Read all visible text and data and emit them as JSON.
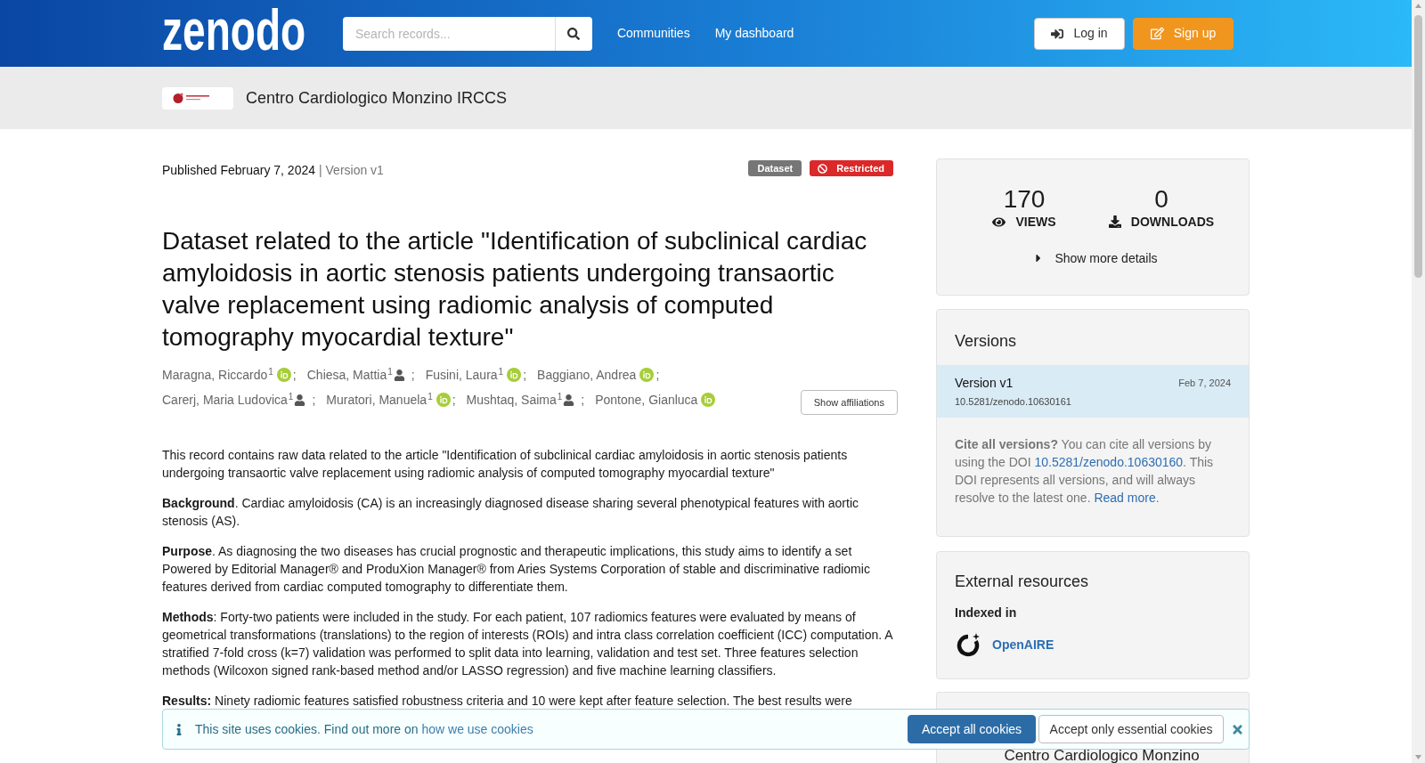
{
  "header": {
    "logo": "zenodo",
    "search": {
      "placeholder": "Search records..."
    },
    "nav": [
      "Communities",
      "My dashboard"
    ],
    "buttons": [
      {
        "label": "Log in",
        "kind": "login"
      },
      {
        "label": "Sign up",
        "kind": "signup"
      }
    ]
  },
  "community": {
    "name": "Centro Cardiologico Monzino IRCCS"
  },
  "record": {
    "published": "Published February 7, 2024",
    "version": "| Version v1",
    "badges": [
      {
        "label": "Dataset",
        "kind": "type"
      },
      {
        "label": "Restricted",
        "kind": "access"
      }
    ],
    "title": "Dataset related to the article \"Identification of subclinical cardiac amyloidosis in aortic stenosis patients undergoing transaortic valve replacement using radiomic analysis of computed tomography myocardial texture\"",
    "authors": [
      {
        "name": "Maragna, Riccardo",
        "affiliation": "1",
        "kind": "orcid",
        "separator": ";"
      },
      {
        "name": "Chiesa, Mattia",
        "affiliation": "1",
        "kind": "person",
        "separator": ";"
      },
      {
        "name": "Fusini, Laura",
        "affiliation": "1",
        "kind": "orcid",
        "separator": ";"
      },
      {
        "name": "Baggiano, Andrea",
        "kind": "orcid",
        "separator": ";"
      },
      {
        "name": "Carerj, Maria Ludovica",
        "affiliation": "1",
        "kind": "person",
        "separator": ";"
      },
      {
        "name": "Muratori, Manuela",
        "affiliation": "1",
        "kind": "orcid",
        "separator": ";"
      },
      {
        "name": "Mushtaq, Saima",
        "affiliation": "1",
        "kind": "person",
        "separator": ";"
      },
      {
        "name": "Pontone, Gianluca",
        "kind": "orcid"
      }
    ],
    "show_affiliations": "Show affiliations",
    "description": [
      "This record contains raw data related to the article \"Identification of subclinical cardiac amyloidosis in aortic stenosis patients undergoing transaortic valve replacement using radiomic analysis of computed tomography myocardial texture\"",
      "**Background**. Cardiac amyloidosis (CA) is an increasingly diagnosed disease sharing several phenotypical features with aortic stenosis (AS).",
      "**Purpose**. As diagnosing the two diseases has crucial prognostic and therapeutic implications, this study aims to identify a set Powered by Editorial Manager® and ProduXion Manager® from Aries Systems Corporation of stable and discriminative radiomic features derived from cardiac computed tomography to differentiate them.",
      "**Methods**: Forty-two patients were included in the study. For each patient, 107 radiomics features were evaluated by means of geometrical transformations (translations) to the region of interests (ROIs) and intra class correlation coefficient (ICC) computation. A stratified 7-fold cross (k=7) validation was performed to split data into learning, validation and test set. Three features selection methods (Wilcoxon signed rank-based method and/or LASSO regression) and five machine learning classifiers.",
      "**Results:** Ninety radiomic features satisfied robustness criteria and 10 were kept after feature selection. The best results were"
    ]
  },
  "stats": {
    "items": [
      {
        "kind": "views",
        "value": "170",
        "label": "VIEWS"
      },
      {
        "kind": "downloads",
        "value": "0",
        "label": "DOWNLOADS"
      }
    ],
    "details": {
      "label": "Show more details",
      "expanded": false
    }
  },
  "versions": {
    "heading": "Versions",
    "items": [
      {
        "label": "Version v1",
        "date": "Feb 7, 2024",
        "doi": "10.5281/zenodo.10630161",
        "selected": true
      }
    ],
    "note": {
      "text": "**Cite all versions?** You can cite all versions by using the DOI",
      "doi_link": "10.5281/zenodo.10630160",
      "text_after": ". This DOI represents all versions, and will always resolve to the latest one.",
      "read_more": "Read more",
      "end": "."
    }
  },
  "external_resources": {
    "heading": "External resources",
    "subheading": "Indexed in",
    "links": [
      {
        "label": "OpenAIRE",
        "kind": "openaire"
      }
    ]
  },
  "community_card": {
    "title": "Centro Cardiologico Monzino"
  },
  "cookie_banner": {
    "text": "This site uses cookies. Find out more on",
    "link": "how we use cookies",
    "buttons": [
      {
        "label": "Accept all cookies",
        "kind": "primary"
      },
      {
        "label": "Accept only essential cookies",
        "kind": "secondary"
      }
    ]
  }
}
